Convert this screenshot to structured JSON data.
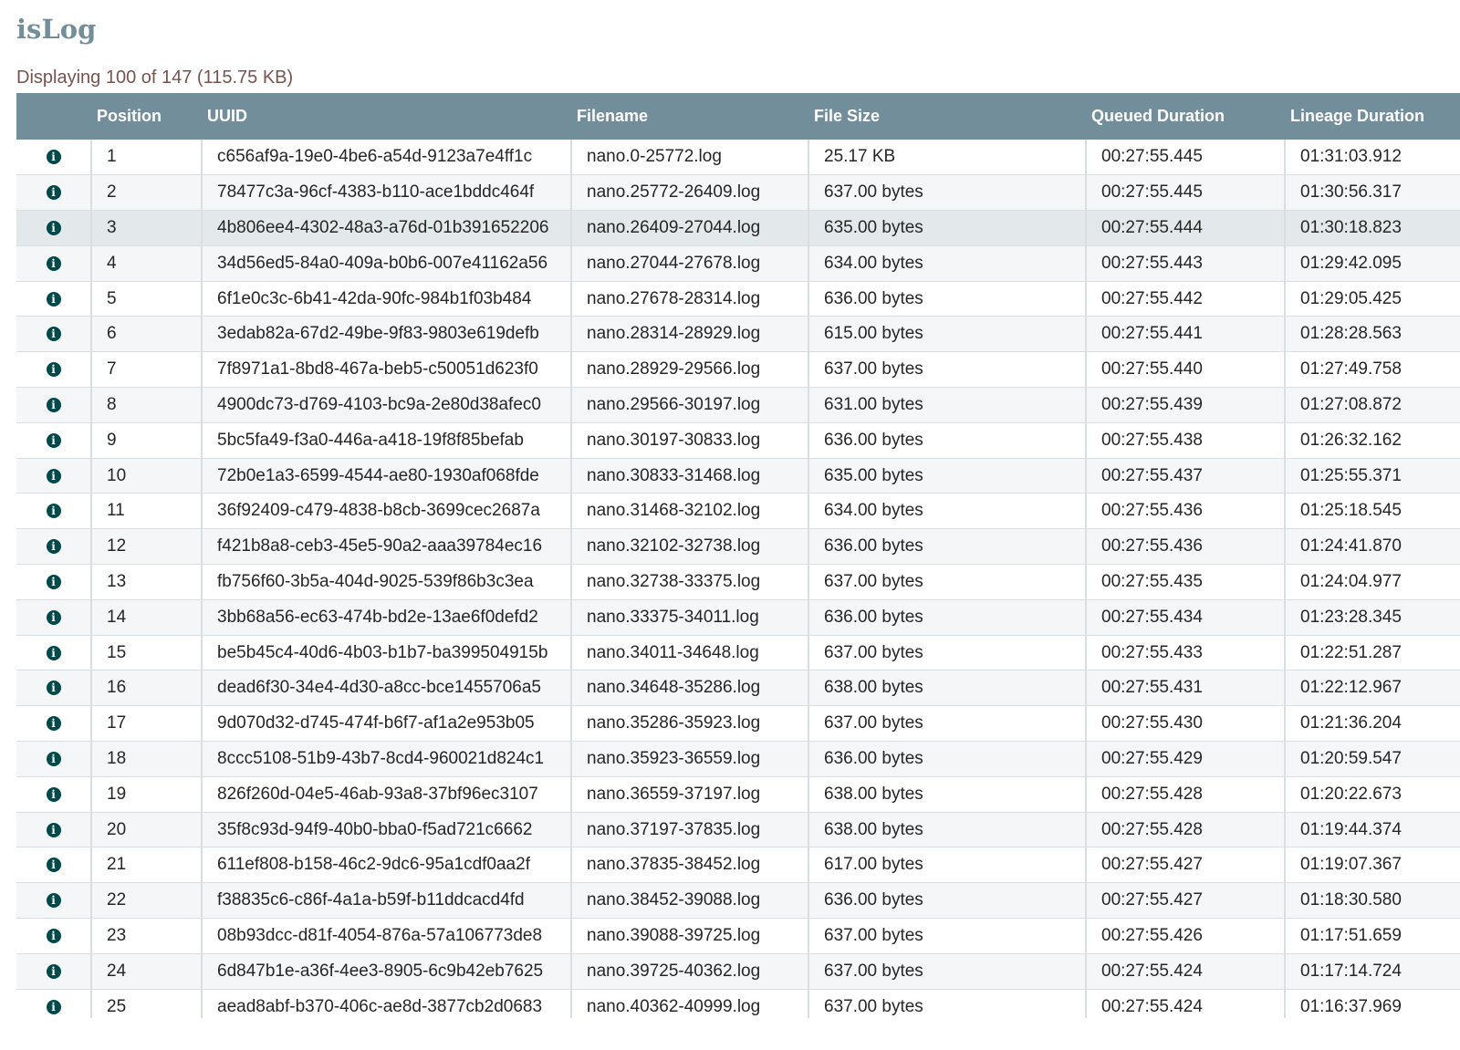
{
  "app": {
    "title": "isLog",
    "summary": "Displaying 100 of 147 (115.75 KB)"
  },
  "table": {
    "columns": [
      "",
      "Position",
      "UUID",
      "Filename",
      "File Size",
      "Queued Duration",
      "Lineage Duration"
    ],
    "rows": [
      {
        "position": "1",
        "uuid": "c656af9a-19e0-4be6-a54d-9123a7e4ff1c",
        "filename": "nano.0-25772.log",
        "size": "25.17 KB",
        "queued": "00:27:55.445",
        "lineage": "01:31:03.912"
      },
      {
        "position": "2",
        "uuid": "78477c3a-96cf-4383-b110-ace1bddc464f",
        "filename": "nano.25772-26409.log",
        "size": "637.00 bytes",
        "queued": "00:27:55.445",
        "lineage": "01:30:56.317"
      },
      {
        "position": "3",
        "uuid": "4b806ee4-4302-48a3-a76d-01b391652206",
        "filename": "nano.26409-27044.log",
        "size": "635.00 bytes",
        "queued": "00:27:55.444",
        "lineage": "01:30:18.823"
      },
      {
        "position": "4",
        "uuid": "34d56ed5-84a0-409a-b0b6-007e41162a56",
        "filename": "nano.27044-27678.log",
        "size": "634.00 bytes",
        "queued": "00:27:55.443",
        "lineage": "01:29:42.095"
      },
      {
        "position": "5",
        "uuid": "6f1e0c3c-6b41-42da-90fc-984b1f03b484",
        "filename": "nano.27678-28314.log",
        "size": "636.00 bytes",
        "queued": "00:27:55.442",
        "lineage": "01:29:05.425"
      },
      {
        "position": "6",
        "uuid": "3edab82a-67d2-49be-9f83-9803e619defb",
        "filename": "nano.28314-28929.log",
        "size": "615.00 bytes",
        "queued": "00:27:55.441",
        "lineage": "01:28:28.563"
      },
      {
        "position": "7",
        "uuid": "7f8971a1-8bd8-467a-beb5-c50051d623f0",
        "filename": "nano.28929-29566.log",
        "size": "637.00 bytes",
        "queued": "00:27:55.440",
        "lineage": "01:27:49.758"
      },
      {
        "position": "8",
        "uuid": "4900dc73-d769-4103-bc9a-2e80d38afec0",
        "filename": "nano.29566-30197.log",
        "size": "631.00 bytes",
        "queued": "00:27:55.439",
        "lineage": "01:27:08.872"
      },
      {
        "position": "9",
        "uuid": "5bc5fa49-f3a0-446a-a418-19f8f85befab",
        "filename": "nano.30197-30833.log",
        "size": "636.00 bytes",
        "queued": "00:27:55.438",
        "lineage": "01:26:32.162"
      },
      {
        "position": "10",
        "uuid": "72b0e1a3-6599-4544-ae80-1930af068fde",
        "filename": "nano.30833-31468.log",
        "size": "635.00 bytes",
        "queued": "00:27:55.437",
        "lineage": "01:25:55.371"
      },
      {
        "position": "11",
        "uuid": "36f92409-c479-4838-b8cb-3699cec2687a",
        "filename": "nano.31468-32102.log",
        "size": "634.00 bytes",
        "queued": "00:27:55.436",
        "lineage": "01:25:18.545"
      },
      {
        "position": "12",
        "uuid": "f421b8a8-ceb3-45e5-90a2-aaa39784ec16",
        "filename": "nano.32102-32738.log",
        "size": "636.00 bytes",
        "queued": "00:27:55.436",
        "lineage": "01:24:41.870"
      },
      {
        "position": "13",
        "uuid": "fb756f60-3b5a-404d-9025-539f86b3c3ea",
        "filename": "nano.32738-33375.log",
        "size": "637.00 bytes",
        "queued": "00:27:55.435",
        "lineage": "01:24:04.977"
      },
      {
        "position": "14",
        "uuid": "3bb68a56-ec63-474b-bd2e-13ae6f0defd2",
        "filename": "nano.33375-34011.log",
        "size": "636.00 bytes",
        "queued": "00:27:55.434",
        "lineage": "01:23:28.345"
      },
      {
        "position": "15",
        "uuid": "be5b45c4-40d6-4b03-b1b7-ba399504915b",
        "filename": "nano.34011-34648.log",
        "size": "637.00 bytes",
        "queued": "00:27:55.433",
        "lineage": "01:22:51.287"
      },
      {
        "position": "16",
        "uuid": "dead6f30-34e4-4d30-a8cc-bce1455706a5",
        "filename": "nano.34648-35286.log",
        "size": "638.00 bytes",
        "queued": "00:27:55.431",
        "lineage": "01:22:12.967"
      },
      {
        "position": "17",
        "uuid": "9d070d32-d745-474f-b6f7-af1a2e953b05",
        "filename": "nano.35286-35923.log",
        "size": "637.00 bytes",
        "queued": "00:27:55.430",
        "lineage": "01:21:36.204"
      },
      {
        "position": "18",
        "uuid": "8ccc5108-51b9-43b7-8cd4-960021d824c1",
        "filename": "nano.35923-36559.log",
        "size": "636.00 bytes",
        "queued": "00:27:55.429",
        "lineage": "01:20:59.547"
      },
      {
        "position": "19",
        "uuid": "826f260d-04e5-46ab-93a8-37bf96ec3107",
        "filename": "nano.36559-37197.log",
        "size": "638.00 bytes",
        "queued": "00:27:55.428",
        "lineage": "01:20:22.673"
      },
      {
        "position": "20",
        "uuid": "35f8c93d-94f9-40b0-bba0-f5ad721c6662",
        "filename": "nano.37197-37835.log",
        "size": "638.00 bytes",
        "queued": "00:27:55.428",
        "lineage": "01:19:44.374"
      },
      {
        "position": "21",
        "uuid": "611ef808-b158-46c2-9dc6-95a1cdf0aa2f",
        "filename": "nano.37835-38452.log",
        "size": "617.00 bytes",
        "queued": "00:27:55.427",
        "lineage": "01:19:07.367"
      },
      {
        "position": "22",
        "uuid": "f38835c6-c86f-4a1a-b59f-b11ddcacd4fd",
        "filename": "nano.38452-39088.log",
        "size": "636.00 bytes",
        "queued": "00:27:55.427",
        "lineage": "01:18:30.580"
      },
      {
        "position": "23",
        "uuid": "08b93dcc-d81f-4054-876a-57a106773de8",
        "filename": "nano.39088-39725.log",
        "size": "637.00 bytes",
        "queued": "00:27:55.426",
        "lineage": "01:17:51.659"
      },
      {
        "position": "24",
        "uuid": "6d847b1e-a36f-4ee3-8905-6c9b42eb7625",
        "filename": "nano.39725-40362.log",
        "size": "637.00 bytes",
        "queued": "00:27:55.424",
        "lineage": "01:17:14.724"
      },
      {
        "position": "25",
        "uuid": "aead8abf-b370-406c-ae8d-3877cb2d0683",
        "filename": "nano.40362-40999.log",
        "size": "637.00 bytes",
        "queued": "00:27:55.424",
        "lineage": "01:16:37.969"
      }
    ]
  },
  "icons": {
    "row_icon": "info-icon",
    "row_icon_glyph": "i"
  },
  "colors": {
    "title": "#728e9b",
    "summary": "#775351",
    "header_bg": "#728e9b",
    "info_icon": "#004849"
  }
}
